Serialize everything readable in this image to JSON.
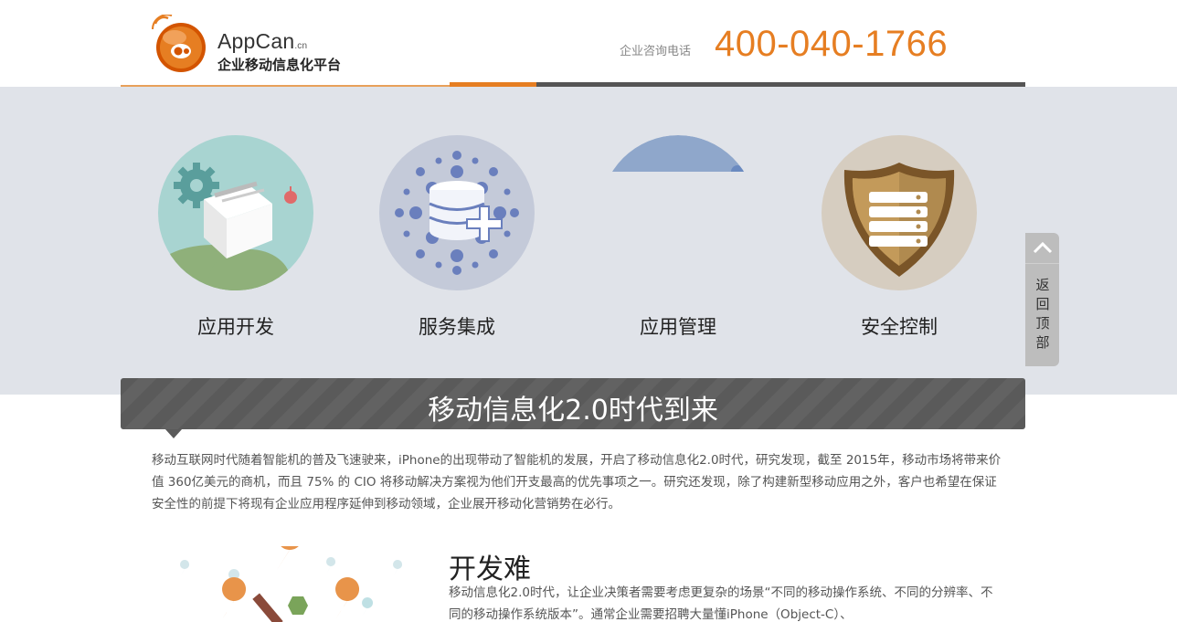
{
  "header": {
    "brand_main": "AppCan",
    "brand_sub": ".cn",
    "brand_tagline": "企业移动信息化平台",
    "hotline_label": "企业咨询电话",
    "hotline_number": "400-040-1766"
  },
  "features": [
    {
      "label": "应用开发",
      "icon": "app-development-icon"
    },
    {
      "label": "服务集成",
      "icon": "service-integration-icon"
    },
    {
      "label": "应用管理",
      "icon": "app-management-icon"
    },
    {
      "label": "安全控制",
      "icon": "security-control-icon"
    }
  ],
  "back_to_top": {
    "label": "返回顶部",
    "icon": "chevron-up-icon"
  },
  "section": {
    "title": "移动信息化2.0时代到来",
    "intro": "移动互联网时代随着智能机的普及飞速驶来，iPhone的出现带动了智能机的发展，开启了移动信息化2.0时代，研究发现，截至 2015年，移动市场将带来价值 360亿美元的商机，而且 75% 的 CIO 将移动解决方案视为他们开支最高的优先事项之一。研究还发现，除了构建新型移动应用之外，客户也希望在保证安全性的前提下将现有企业应用程序延伸到移动领域，企业展开移动化营销势在必行。"
  },
  "dev": {
    "title": "开发难",
    "text": "移动信息化2.0时代，让企业决策者需要考虑更复杂的场景“不同的移动操作系统、不同的分辨率、不同的移动操作系统版本”。通常企业需要招聘大量懂iPhone（Object-C）、"
  },
  "colors": {
    "accent": "#e67e22",
    "band": "#e0e3e9",
    "banner": "#5a5a5a"
  }
}
